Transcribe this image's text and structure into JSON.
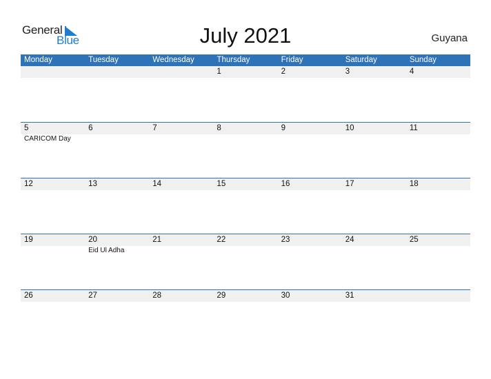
{
  "logo": {
    "word1": "General",
    "word2": "Blue"
  },
  "title": "July 2021",
  "country": "Guyana",
  "colors": {
    "header": "#2e72b8",
    "brand": "#1e7bd1",
    "day_strip": "#f0f0f0"
  },
  "weekdays": [
    "Monday",
    "Tuesday",
    "Wednesday",
    "Thursday",
    "Friday",
    "Saturday",
    "Sunday"
  ],
  "weeks": [
    {
      "days": [
        "",
        "",
        "",
        "1",
        "2",
        "3",
        "4"
      ],
      "events": [
        "",
        "",
        "",
        "",
        "",
        "",
        ""
      ]
    },
    {
      "days": [
        "5",
        "6",
        "7",
        "8",
        "9",
        "10",
        "11"
      ],
      "events": [
        "CARICOM Day",
        "",
        "",
        "",
        "",
        "",
        ""
      ]
    },
    {
      "days": [
        "12",
        "13",
        "14",
        "15",
        "16",
        "17",
        "18"
      ],
      "events": [
        "",
        "",
        "",
        "",
        "",
        "",
        ""
      ]
    },
    {
      "days": [
        "19",
        "20",
        "21",
        "22",
        "23",
        "24",
        "25"
      ],
      "events": [
        "",
        "Eid Ul Adha",
        "",
        "",
        "",
        "",
        ""
      ]
    },
    {
      "days": [
        "26",
        "27",
        "28",
        "29",
        "30",
        "31",
        ""
      ],
      "events": [
        "",
        "",
        "",
        "",
        "",
        "",
        ""
      ]
    }
  ]
}
